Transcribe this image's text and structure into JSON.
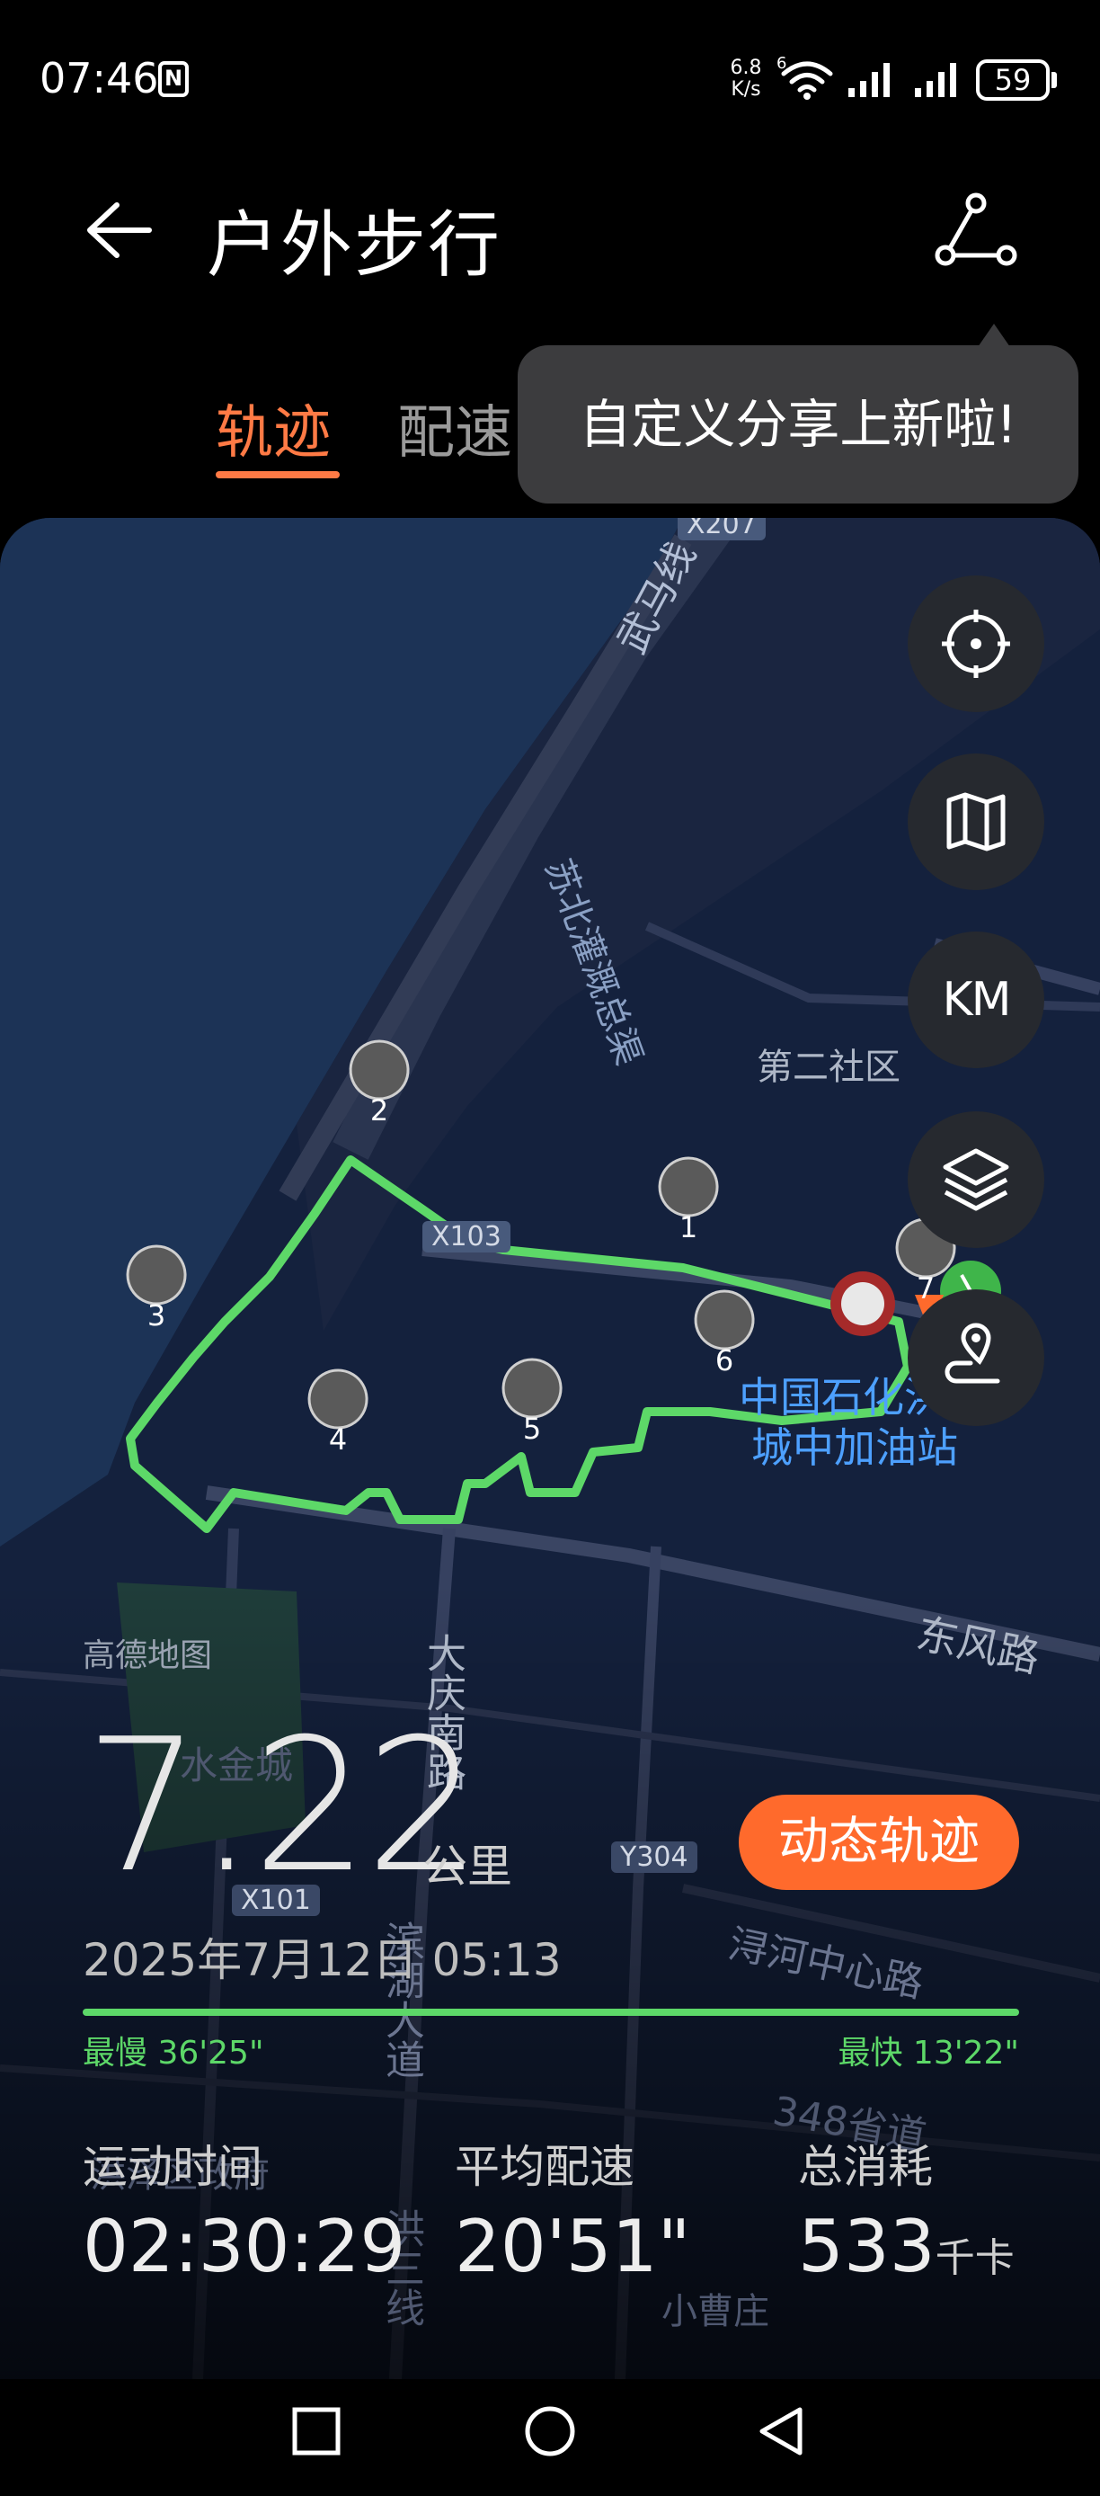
{
  "status_bar": {
    "time": "07:46",
    "nfc_label": "N",
    "net_speed_value": "6.8",
    "net_speed_unit": "K/s",
    "wifi_badge": "6",
    "battery": "59"
  },
  "header": {
    "title": "户外步行"
  },
  "tabs": {
    "items": [
      {
        "label": "轨迹",
        "active": true
      },
      {
        "label": "配速",
        "active": false
      }
    ]
  },
  "tooltip": {
    "text": "自定义分享上新啦!"
  },
  "map": {
    "provider": "高德地图",
    "route_color": "#5dd868",
    "labels": {
      "x207": "X207",
      "wuma": "武马线",
      "subei": "苏北灌溉总渠",
      "dier": "第二社区",
      "x103": "X103",
      "station1": "中国石化洪泽",
      "station2": "城中加油站",
      "dongfeng": "东风路",
      "daqing": "大庆南路",
      "x101": "X101",
      "y304": "Y304",
      "xunhe": "浔河中心路",
      "binhu": "滨湖大道",
      "hongsan": "洪三线",
      "s348": "348省道",
      "xiaocao": "小曹庄",
      "shuijin": "水金城",
      "hongze": "洪泽区政府"
    },
    "km_markers": [
      "1",
      "2",
      "3",
      "4",
      "5",
      "6",
      "7"
    ],
    "controls": {
      "km_label": "KM"
    }
  },
  "summary": {
    "distance": "7.22",
    "distance_unit": "公里",
    "replay_button": "动态轨迹",
    "date": "2025年7月12日 05:13",
    "slowest": "最慢 36'25\"",
    "fastest": "最快 13'22\""
  },
  "stats": [
    {
      "label": "运动时间",
      "value": "02:30:29",
      "unit": ""
    },
    {
      "label": "平均配速",
      "value": "20'51\"",
      "unit": ""
    },
    {
      "label": "总消耗",
      "value": "533",
      "unit": "千卡"
    }
  ],
  "colors": {
    "accent": "#ff7a45",
    "replay_button": "#ff6a2c",
    "route": "#5dd868"
  }
}
